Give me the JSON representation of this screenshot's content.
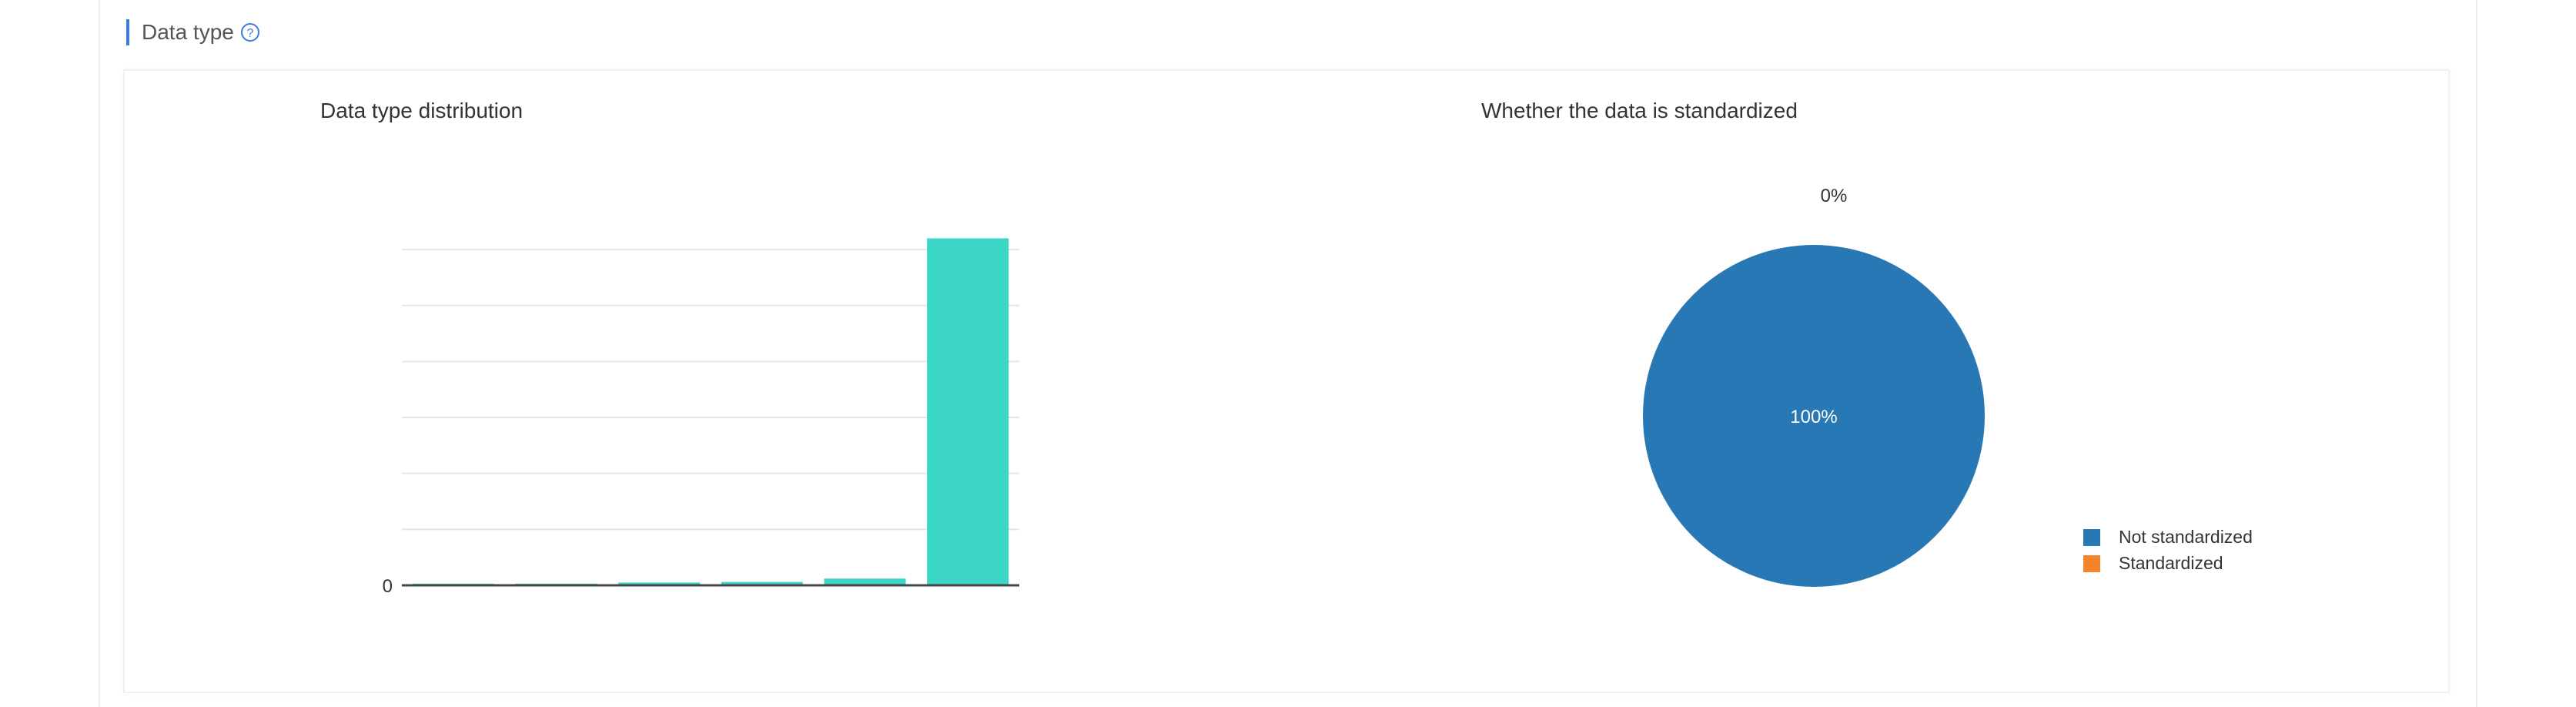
{
  "section": {
    "title": "Data type",
    "help_icon": "help-circle-icon",
    "accent_color": "#3d7bd6"
  },
  "chart_data": [
    {
      "type": "bar",
      "title": "Data type distribution",
      "categories": [
        "",
        "",
        "",
        "",
        "",
        ""
      ],
      "values": [
        3,
        3,
        5,
        6,
        12,
        620
      ],
      "color": "#3bd6c6",
      "ylim": [
        0,
        600
      ],
      "yticks": [
        "0",
        "",
        "",
        "",
        "",
        "",
        ""
      ],
      "grid": true,
      "legend": "none"
    },
    {
      "type": "pie",
      "title": "Whether the data is standardized",
      "labels": [
        "Not standardized",
        "Standardized"
      ],
      "values": [
        100,
        0
      ],
      "data_labels": [
        "100%",
        "0%"
      ],
      "colors": [
        "#2778b4",
        "#f5832a"
      ],
      "legend": "right-bottom"
    }
  ]
}
